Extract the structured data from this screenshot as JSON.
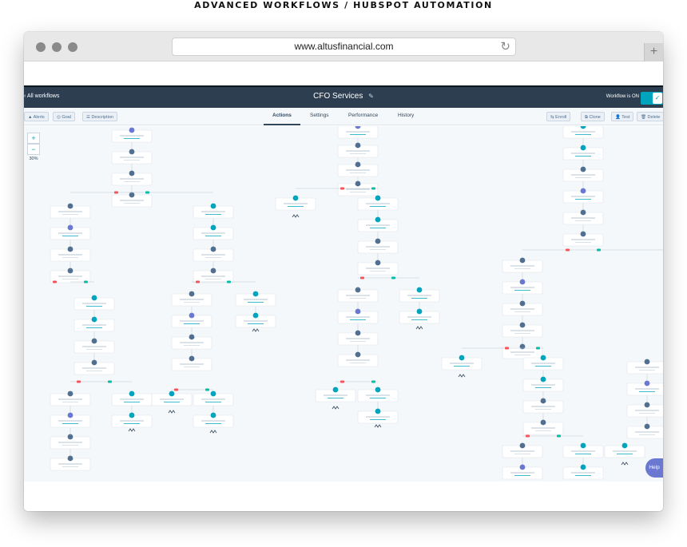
{
  "caption": "ADVANCED WORKFLOWS / HUBSPOT AUTOMATION",
  "browser": {
    "url": "www.altusfinancial.com",
    "reload_icon": "reload-icon",
    "new_tab_label": "+"
  },
  "workflow": {
    "back_label": "‹ All workflows",
    "title": "CFO Services",
    "status_label": "Workflow is ON",
    "toggle_check": "✓"
  },
  "toolbar": {
    "alerts": "▲ Alerts",
    "goal": "◎ Goal",
    "description": "☰ Description",
    "tabs": [
      "Actions",
      "Settings",
      "Performance",
      "History"
    ],
    "active_tab": "Actions",
    "enroll": "⇆ Enroll",
    "clone": "⧉ Clone",
    "test": "👤 Test",
    "delete": "🗑 Delete"
  },
  "zoom": {
    "plus": "+",
    "minus": "−",
    "level": "30%"
  },
  "help_label": "Help",
  "colors": {
    "nav_bg": "#2d3e50",
    "accent": "#00a4bd",
    "delay_node": "#516f90",
    "email_node": "#6a78d1",
    "branch_yes": "#00bda5",
    "branch_no": "#f2545b",
    "canvas_bg": "#f5f8fa"
  }
}
